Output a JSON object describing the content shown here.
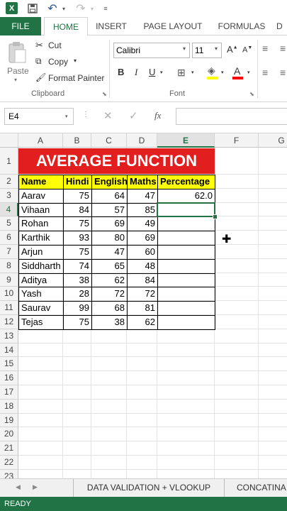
{
  "qat": {
    "app_icon": "X"
  },
  "tabs": {
    "file": "FILE",
    "home": "HOME",
    "insert": "INSERT",
    "page_layout": "PAGE LAYOUT",
    "formulas": "FORMULAS",
    "data": "D"
  },
  "ribbon": {
    "paste": "Paste",
    "cut": "Cut",
    "copy": "Copy",
    "format_painter": "Format Painter",
    "clipboard_group": "Clipboard",
    "font_name": "Calibri",
    "font_size": "11",
    "font_group": "Font",
    "bold": "B",
    "italic": "I",
    "underline": "U"
  },
  "formula_bar": {
    "name_box": "E4",
    "fx": "fx",
    "formula": ""
  },
  "grid": {
    "columns": [
      "A",
      "B",
      "C",
      "D",
      "E",
      "F",
      "G"
    ],
    "selected_column": "E",
    "selected_row": "4",
    "rows": [
      "1",
      "2",
      "3",
      "4",
      "5",
      "6",
      "7",
      "8",
      "9",
      "10",
      "11",
      "12",
      "13",
      "14",
      "15",
      "16",
      "17",
      "18",
      "19",
      "20",
      "21",
      "22",
      "23"
    ]
  },
  "sheet": {
    "title": "AVERAGE FUNCTION",
    "headers": [
      "Name",
      "Hindi",
      "English",
      "Maths",
      "Percentage"
    ],
    "records": [
      {
        "name": "Aarav",
        "hindi": "75",
        "english": "64",
        "maths": "47",
        "percentage": "62.0"
      },
      {
        "name": "Vihaan",
        "hindi": "84",
        "english": "57",
        "maths": "85",
        "percentage": ""
      },
      {
        "name": "Rohan",
        "hindi": "75",
        "english": "69",
        "maths": "49",
        "percentage": ""
      },
      {
        "name": "Karthik",
        "hindi": "93",
        "english": "80",
        "maths": "69",
        "percentage": ""
      },
      {
        "name": "Arjun",
        "hindi": "75",
        "english": "47",
        "maths": "60",
        "percentage": ""
      },
      {
        "name": "Siddharth",
        "hindi": "74",
        "english": "65",
        "maths": "48",
        "percentage": ""
      },
      {
        "name": "Aditya",
        "hindi": "38",
        "english": "62",
        "maths": "84",
        "percentage": ""
      },
      {
        "name": "Yash",
        "hindi": "28",
        "english": "72",
        "maths": "72",
        "percentage": ""
      },
      {
        "name": "Saurav",
        "hindi": "99",
        "english": "68",
        "maths": "81",
        "percentage": ""
      },
      {
        "name": "Tejas",
        "hindi": "75",
        "english": "38",
        "maths": "62",
        "percentage": ""
      }
    ]
  },
  "sheet_tabs": [
    "DATA VALIDATION + VLOOKUP",
    "CONCATINA"
  ],
  "status": "READY",
  "colors": {
    "excel_green": "#217346",
    "title_red": "#e31e1e",
    "header_yellow": "#ffff00"
  }
}
